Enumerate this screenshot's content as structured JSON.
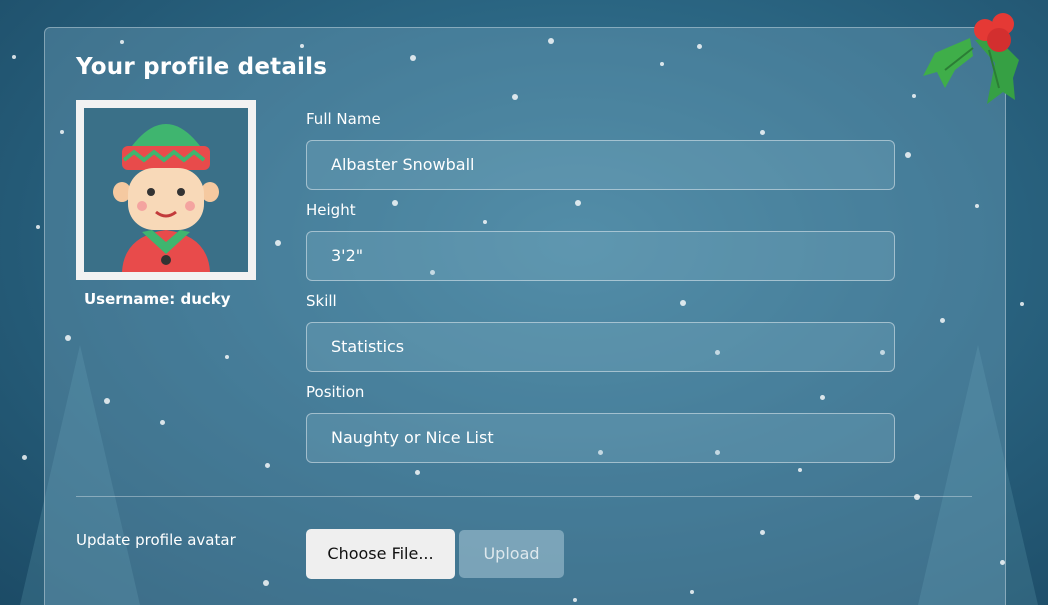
{
  "page": {
    "title": "Your profile details"
  },
  "profile": {
    "avatar_icon": "elf-avatar",
    "username_text": "Username: ducky"
  },
  "fields": {
    "full_name": {
      "label": "Full Name",
      "value": "Albaster Snowball"
    },
    "height": {
      "label": "Height",
      "value": "3'2\""
    },
    "skill": {
      "label": "Skill",
      "value": "Statistics"
    },
    "position": {
      "label": "Position",
      "value": "Naughty or Nice List"
    }
  },
  "upload": {
    "label": "Update profile avatar",
    "choose_label": "Choose File...",
    "upload_label": "Upload"
  },
  "decor": {
    "corner_icon": "holly-icon",
    "colors": {
      "background": "#2b6683",
      "holly_leaf": "#3fae49",
      "holly_berry": "#e53935",
      "elf_hat": "#3fb56f",
      "elf_hat_band": "#e84b4b"
    }
  }
}
